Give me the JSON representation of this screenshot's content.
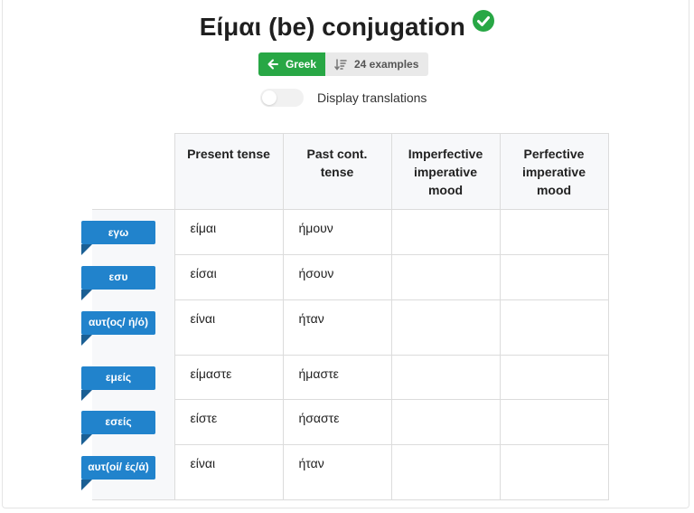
{
  "page": {
    "title": "Είμαι (be) conjugation"
  },
  "buttons": {
    "language": "Greek",
    "examples": "24 examples"
  },
  "toggle": {
    "label": "Display translations",
    "on": false
  },
  "table": {
    "headers": [
      "Present tense",
      "Past cont. tense",
      "Imperfective imperative mood",
      "Perfective imperative mood"
    ],
    "rows": [
      {
        "pronoun": "εγω",
        "present": "είμαι",
        "past": "ήμουν",
        "imperfective": "",
        "perfective": ""
      },
      {
        "pronoun": "εσυ",
        "present": "είσαι",
        "past": "ήσουν",
        "imperfective": "",
        "perfective": ""
      },
      {
        "pronoun": "αυτ(ος/ ή/ό)",
        "present": "είναι",
        "past": "ήταν",
        "imperfective": "",
        "perfective": ""
      },
      {
        "pronoun": "εμείς",
        "present": "είμαστε",
        "past": "ήμαστε",
        "imperfective": "",
        "perfective": ""
      },
      {
        "pronoun": "εσείς",
        "present": "είστε",
        "past": "ήσαστε",
        "imperfective": "",
        "perfective": ""
      },
      {
        "pronoun": "αυτ(οί/ ές/ά)",
        "present": "είναι",
        "past": "ήταν",
        "imperfective": "",
        "perfective": ""
      }
    ]
  },
  "colors": {
    "accent_green": "#28a745",
    "pronoun_blue": "#2183cc",
    "check_green": "#28a745"
  },
  "icons": {
    "title_status": "check-circle-icon",
    "back": "arrow-left-icon",
    "examples": "sort-lines-icon"
  }
}
